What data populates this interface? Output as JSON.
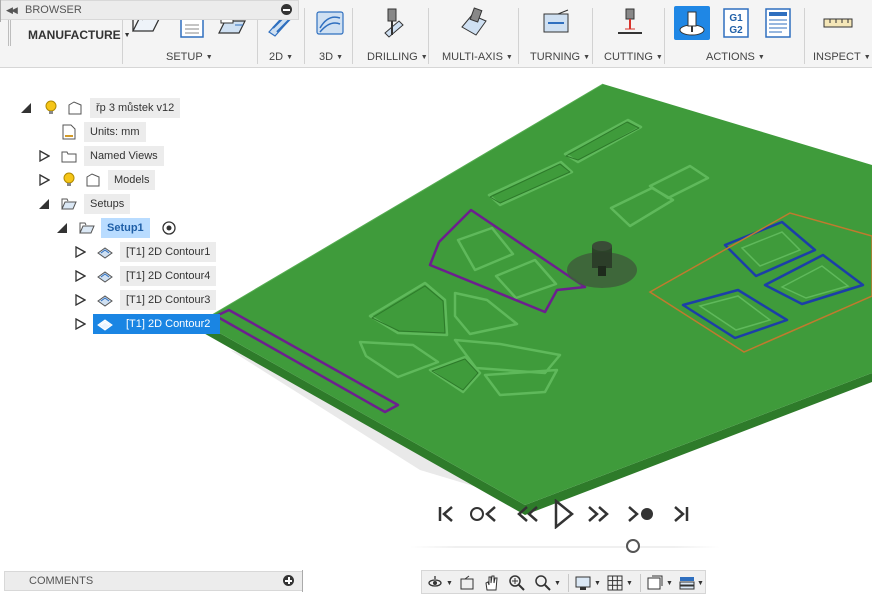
{
  "toolbar": {
    "workspace_label": "MANUFACTURE",
    "groups": [
      {
        "label": "SETUP"
      },
      {
        "label": "2D"
      },
      {
        "label": "3D"
      },
      {
        "label": "DRILLING"
      },
      {
        "label": "MULTI-AXIS"
      },
      {
        "label": "TURNING"
      },
      {
        "label": "CUTTING"
      },
      {
        "label": "ACTIONS"
      },
      {
        "label": "INSPECT"
      }
    ],
    "gcode_icon_text_top": "G1",
    "gcode_icon_text_bottom": "G2",
    "setup_icon_letter": "G"
  },
  "browser": {
    "title": "BROWSER",
    "tree": [
      {
        "label": "řp 3 můstek v12",
        "icon": "lightbulb-icon"
      },
      {
        "label": "Units: mm",
        "icon": "document-icon"
      },
      {
        "label": "Named Views",
        "icon": "folder-icon"
      },
      {
        "label": "Models",
        "icon": "lightbulb-icon"
      },
      {
        "label": "Setups",
        "icon": "folder-open-icon"
      },
      {
        "label": "Setup1",
        "icon": "folder-open-icon"
      },
      {
        "label": "[T1] 2D Contour1",
        "icon": "contour-op-icon"
      },
      {
        "label": "[T1] 2D Contour4",
        "icon": "contour-op-icon"
      },
      {
        "label": "[T1] 2D Contour3",
        "icon": "contour-op-icon"
      },
      {
        "label": "[T1] 2D Contour2",
        "icon": "contour-op-icon",
        "selected": true
      }
    ]
  },
  "comments": {
    "title": "COMMENTS"
  },
  "playback": {
    "progress": 0.72
  },
  "colors": {
    "stock_top": "#3f9b3b",
    "stock_side": "#2f7a2c",
    "toolpath_purple": "#6d1f8f",
    "toolpath_blue": "#1c3fa8",
    "setup_frame": "#c07a2e",
    "selection": "#1a85e3"
  }
}
